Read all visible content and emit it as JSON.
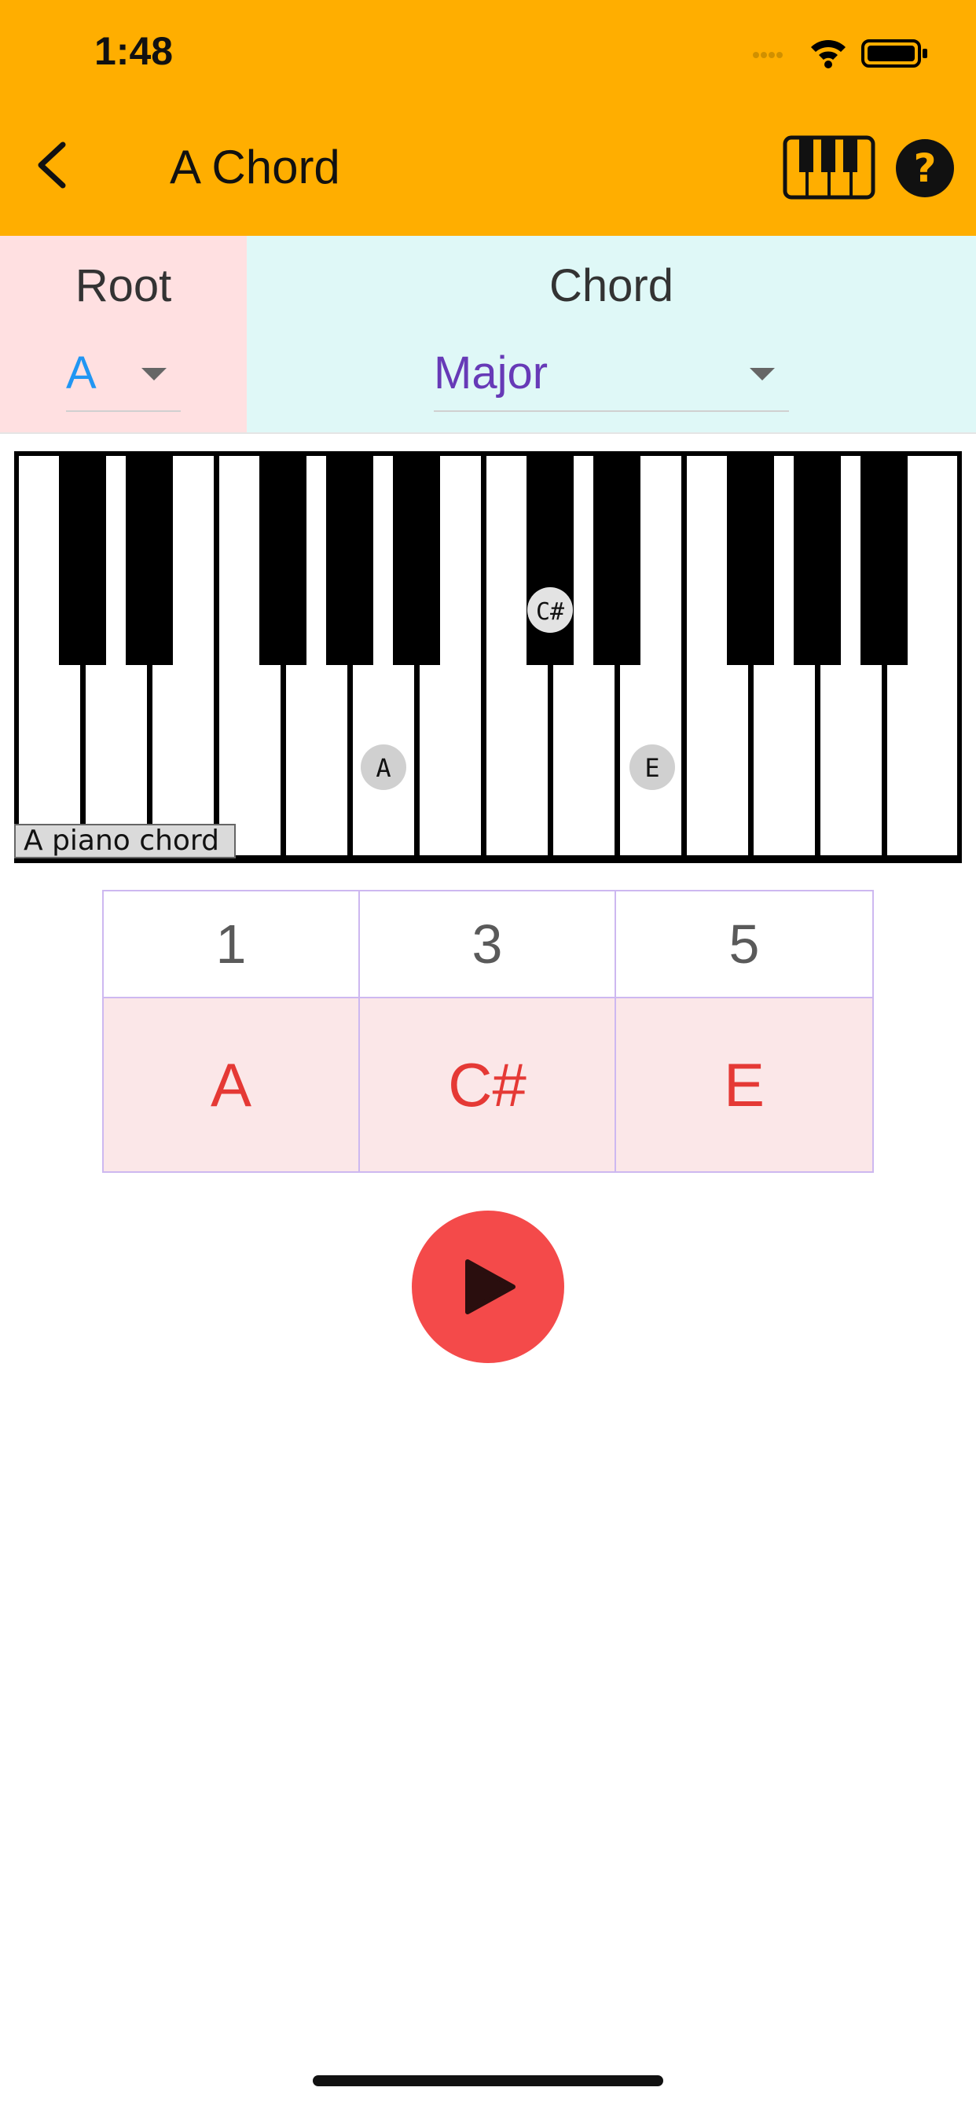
{
  "status_bar": {
    "time": "1:48"
  },
  "header": {
    "title": "A Chord",
    "back_icon": "chevron-left-icon",
    "piano_icon": "piano-icon",
    "help_icon": "help-circle-icon",
    "bar_color": "#FFAE00"
  },
  "selectors": {
    "root": {
      "label": "Root",
      "value": "A",
      "value_color": "#2196F3"
    },
    "chord": {
      "label": "Chord",
      "value": "Major",
      "value_color": "#673AB7"
    }
  },
  "piano": {
    "caption": "A piano chord",
    "highlighted_notes": [
      "A",
      "C#",
      "E"
    ]
  },
  "intervals": {
    "degrees": [
      "1",
      "3",
      "5"
    ],
    "notes": [
      "A",
      "C#",
      "E"
    ]
  },
  "actions": {
    "play_icon": "play-icon",
    "play_color": "#F44A4A"
  }
}
